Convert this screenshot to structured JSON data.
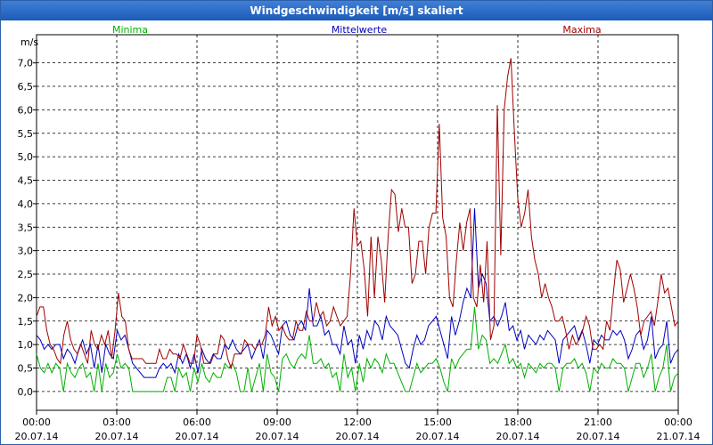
{
  "window": {
    "title": "Windgeschwindigkeit [m/s] skaliert"
  },
  "chart_data": {
    "type": "line",
    "title": "Windgeschwindigkeit [m/s] skaliert",
    "ylabel": "m/s",
    "ylim": [
      -0.4,
      7.6
    ],
    "yticks": [
      "0,0",
      "0,5",
      "1,0",
      "1,5",
      "2,0",
      "2,5",
      "3,0",
      "3,5",
      "4,0",
      "4,5",
      "5,0",
      "5,5",
      "6,0",
      "6,5",
      "7,0"
    ],
    "x_tick_labels": [
      {
        "time": "00:00",
        "date": "20.07.14"
      },
      {
        "time": "03:00",
        "date": "20.07.14"
      },
      {
        "time": "06:00",
        "date": "20.07.14"
      },
      {
        "time": "09:00",
        "date": "20.07.14"
      },
      {
        "time": "12:00",
        "date": "20.07.14"
      },
      {
        "time": "15:00",
        "date": "20.07.14"
      },
      {
        "time": "18:00",
        "date": "20.07.14"
      },
      {
        "time": "21:00",
        "date": "20.07.14"
      },
      {
        "time": "00:00",
        "date": "21.07.14"
      }
    ],
    "grid": true,
    "legend_position": "top",
    "x_start": "20.07.14 00:00",
    "x_end": "21.07.14 00:00",
    "series": [
      {
        "name": "Minima",
        "color": "#00b000",
        "values": [
          0.8,
          0.5,
          0.4,
          0.6,
          0.4,
          0.6,
          0.5,
          0.0,
          0.6,
          0.4,
          0.3,
          0.5,
          0.6,
          0.3,
          0.4,
          0.0,
          0.6,
          0.0,
          0.6,
          0.3,
          0.4,
          0.8,
          0.5,
          0.6,
          0.5,
          0.0,
          0.0,
          0.0,
          0.0,
          0.0,
          0.0,
          0.0,
          0.0,
          0.0,
          0.3,
          0.3,
          0.0,
          0.5,
          0.3,
          0.4,
          0.0,
          0.5,
          0.2,
          0.6,
          0.3,
          0.2,
          0.4,
          0.3,
          0.3,
          0.6,
          0.5,
          0.6,
          0.4,
          0.0,
          0.0,
          0.5,
          0.0,
          0.3,
          0.6,
          0.0,
          0.8,
          0.4,
          0.3,
          0.0,
          0.7,
          0.8,
          0.6,
          0.5,
          0.7,
          0.8,
          0.7,
          1.2,
          0.6,
          0.6,
          0.7,
          0.5,
          0.6,
          0.3,
          0.4,
          0.0,
          0.8,
          0.3,
          0.5,
          0.0,
          0.6,
          0.2,
          0.7,
          0.5,
          0.7,
          0.6,
          0.4,
          0.8,
          0.6,
          0.6,
          0.4,
          0.2,
          0.0,
          0.0,
          0.3,
          0.6,
          0.4,
          0.5,
          0.6,
          0.6,
          0.7,
          0.5,
          0.2,
          0.0,
          0.7,
          0.5,
          0.7,
          0.8,
          0.9,
          0.9,
          1.8,
          0.9,
          1.2,
          1.1,
          0.6,
          0.7,
          0.6,
          0.8,
          1.0,
          0.6,
          0.7,
          0.5,
          0.6,
          0.3,
          0.6,
          0.5,
          0.4,
          0.6,
          0.5,
          0.6,
          0.6,
          0.5,
          0.0,
          0.5,
          0.6,
          0.6,
          0.7,
          0.5,
          0.6,
          0.4,
          0.0,
          0.5,
          0.4,
          0.6,
          0.5,
          0.5,
          0.7,
          0.6,
          0.6,
          0.5,
          0.0,
          0.3,
          0.6,
          0.6,
          0.3,
          0.5,
          0.8,
          0.0,
          0.3,
          0.5,
          1.0,
          0.0,
          0.3,
          0.4
        ]
      },
      {
        "name": "Mittelwerte",
        "color": "#0000c0",
        "values": [
          1.2,
          1.1,
          0.9,
          1.0,
          0.9,
          1.0,
          1.0,
          0.7,
          0.9,
          0.8,
          0.6,
          0.9,
          1.1,
          0.8,
          1.0,
          0.5,
          1.0,
          0.4,
          1.0,
          0.8,
          0.7,
          1.3,
          1.1,
          1.2,
          0.9,
          0.6,
          0.5,
          0.4,
          0.3,
          0.3,
          0.3,
          0.3,
          0.5,
          0.6,
          0.5,
          0.6,
          0.4,
          0.8,
          0.6,
          0.8,
          0.5,
          0.8,
          0.4,
          0.9,
          0.7,
          0.6,
          0.8,
          0.7,
          0.7,
          1.0,
          0.9,
          1.1,
          0.9,
          0.8,
          0.9,
          1.0,
          0.7,
          0.9,
          1.1,
          0.7,
          1.3,
          1.2,
          1.0,
          0.8,
          1.4,
          1.5,
          1.2,
          1.1,
          1.4,
          1.5,
          1.3,
          2.2,
          1.4,
          1.4,
          1.6,
          1.2,
          1.3,
          1.0,
          1.0,
          0.8,
          1.4,
          1.0,
          1.1,
          0.6,
          1.2,
          0.9,
          1.3,
          1.1,
          1.5,
          1.4,
          1.1,
          1.6,
          1.4,
          1.3,
          1.2,
          0.9,
          0.6,
          0.5,
          0.9,
          1.2,
          1.0,
          1.1,
          1.4,
          1.5,
          1.6,
          1.3,
          1.0,
          0.7,
          1.6,
          1.2,
          1.5,
          1.9,
          2.2,
          2.0,
          3.9,
          2.2,
          2.5,
          2.3,
          1.5,
          1.6,
          1.4,
          1.6,
          1.9,
          1.3,
          1.4,
          1.1,
          1.3,
          0.9,
          1.2,
          1.1,
          1.0,
          1.2,
          1.1,
          1.3,
          1.2,
          1.1,
          0.6,
          1.1,
          1.2,
          1.3,
          1.4,
          1.1,
          1.3,
          1.0,
          0.6,
          1.1,
          1.0,
          1.2,
          1.1,
          1.1,
          1.3,
          1.2,
          1.3,
          1.1,
          0.7,
          0.9,
          1.2,
          1.3,
          0.9,
          1.1,
          1.6,
          0.7,
          0.9,
          1.0,
          1.5,
          0.6,
          0.8,
          0.9
        ]
      },
      {
        "name": "Maxima",
        "color": "#a00000",
        "values": [
          1.6,
          1.8,
          1.8,
          1.3,
          1.0,
          0.9,
          0.7,
          0.6,
          1.2,
          1.5,
          1.1,
          0.9,
          0.8,
          1.0,
          0.8,
          0.6,
          1.3,
          1.0,
          0.9,
          1.2,
          1.0,
          1.3,
          0.7,
          1.3,
          2.1,
          1.6,
          1.5,
          0.9,
          0.7,
          0.7,
          0.7,
          0.7,
          0.6,
          0.6,
          0.6,
          0.6,
          0.9,
          0.7,
          0.7,
          0.9,
          0.8,
          0.8,
          0.7,
          1.0,
          0.8,
          0.6,
          0.6,
          1.2,
          1.0,
          0.6,
          0.6,
          0.6,
          0.8,
          0.8,
          1.2,
          1.1,
          0.7,
          0.5,
          0.8,
          0.8,
          0.8,
          1.1,
          1.0,
          1.0,
          0.9,
          1.0,
          1.0,
          1.2,
          1.8,
          1.4,
          1.6,
          1.3,
          1.4,
          1.2,
          1.1,
          1.1,
          1.5,
          1.3,
          1.3,
          1.7,
          1.5,
          1.5,
          1.9,
          1.6,
          1.7,
          1.4,
          1.5,
          1.8,
          1.6,
          1.4,
          1.5,
          1.6,
          2.5,
          3.9,
          3.1,
          3.2,
          2.6,
          1.6,
          3.3,
          2.0,
          3.3,
          2.8,
          1.9,
          3.3,
          4.3,
          4.2,
          3.4,
          3.9,
          3.5,
          3.5,
          2.3,
          2.5,
          3.2,
          3.2,
          2.5,
          3.5,
          3.8,
          3.8,
          5.7,
          3.7,
          3.3,
          2.0,
          1.8,
          2.8,
          3.6,
          3.0,
          3.6,
          3.9,
          2.0,
          1.8,
          2.7,
          1.9,
          3.2,
          1.1,
          1.4,
          6.1,
          2.9,
          6.0,
          6.7,
          7.1,
          5.5,
          4.1,
          3.5,
          3.8,
          4.3,
          3.3,
          2.8,
          2.5,
          2.0,
          2.3,
          2.0,
          1.8,
          1.5,
          1.5,
          1.6,
          1.3,
          0.9,
          1.2,
          1.0,
          1.1,
          1.3,
          1.6,
          1.4,
          0.9,
          0.9,
          1.0,
          0.9,
          1.5,
          1.3,
          2.1,
          2.8,
          2.6,
          1.9,
          2.2,
          2.5,
          2.2,
          1.8,
          1.2,
          1.5,
          1.6,
          1.7,
          1.4,
          1.9,
          2.5,
          2.1,
          2.2,
          1.8,
          1.4,
          1.5
        ]
      }
    ]
  }
}
